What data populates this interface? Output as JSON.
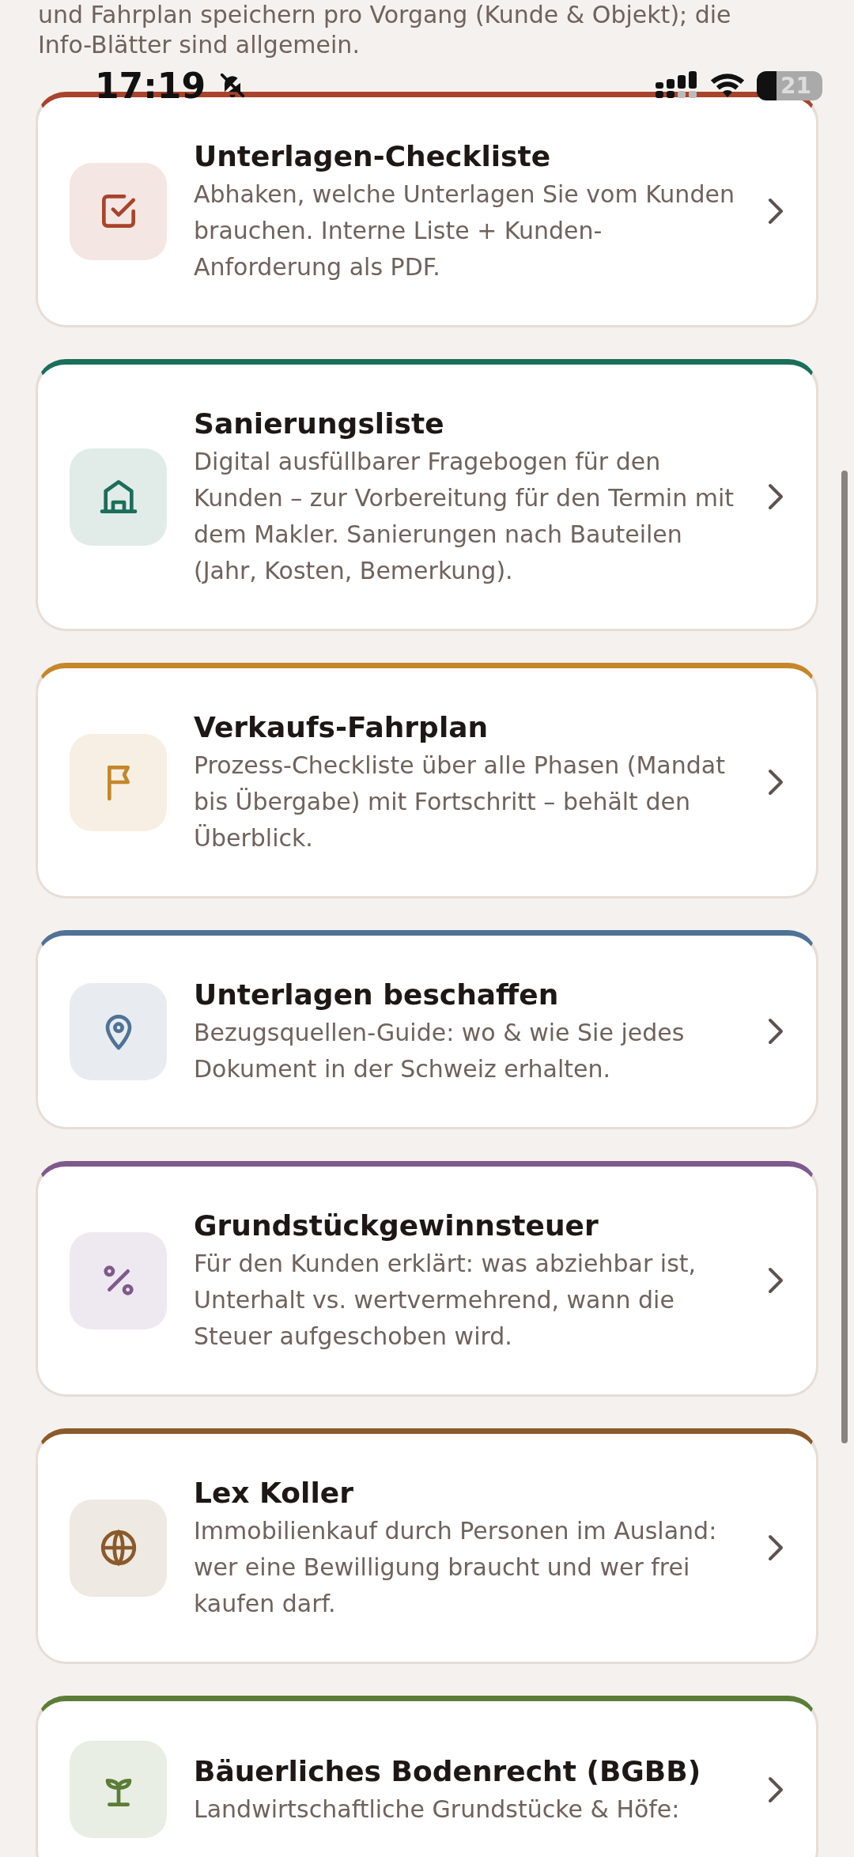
{
  "intro": "und Fahrplan speichern pro Vorgang (Kunde & Objekt); die Info-Blätter sind allgemein.",
  "status_bar": {
    "time": "17:19",
    "battery": "21"
  },
  "cards": [
    {
      "title": "Unterlagen-Checkliste",
      "description": "Abhaken, welche Unterlagen Sie vom Kunden brauchen. Interne Liste + Kunden-Anforderung als PDF.",
      "color": "#a8432c",
      "kind": "checkbox"
    },
    {
      "title": "Sanierungsliste",
      "description": "Digital ausfüllbarer Fragebogen für den Kunden – zur Vorbereitung für den Termin mit dem Makler. Sanierungen nach Bauteilen (Jahr, Kosten, Bemerkung).",
      "color": "#1b6e5a",
      "kind": "house"
    },
    {
      "title": "Verkaufs-Fahrplan",
      "description": "Prozess-Checkliste über alle Phasen (Mandat bis Übergabe) mit Fortschritt – behält den Überblick.",
      "color": "#c4872a",
      "kind": "flag"
    },
    {
      "title": "Unterlagen beschaffen",
      "description": "Bezugsquellen-Guide: wo & wie Sie jedes Dokument in der Schweiz erhalten.",
      "color": "#4f7295",
      "kind": "pin"
    },
    {
      "title": "Grundstückgewinnsteuer",
      "description": "Für den Kunden erklärt: was abziehbar ist, Unterhalt vs. wertvermehrend, wann die Steuer aufgeschoben wird.",
      "color": "#7e5a8c",
      "kind": "percent"
    },
    {
      "title": "Lex Koller",
      "description": "Immobilienkauf durch Personen im Ausland: wer eine Bewilligung braucht und wer frei kaufen darf.",
      "color": "#8a5a2b",
      "kind": "globe"
    },
    {
      "title": "Bäuerliches Bodenrecht (BGBB)",
      "description": "Landwirtschaftliche Grundstücke & Höfe:",
      "color": "#5b7d37",
      "kind": "sprout"
    }
  ]
}
